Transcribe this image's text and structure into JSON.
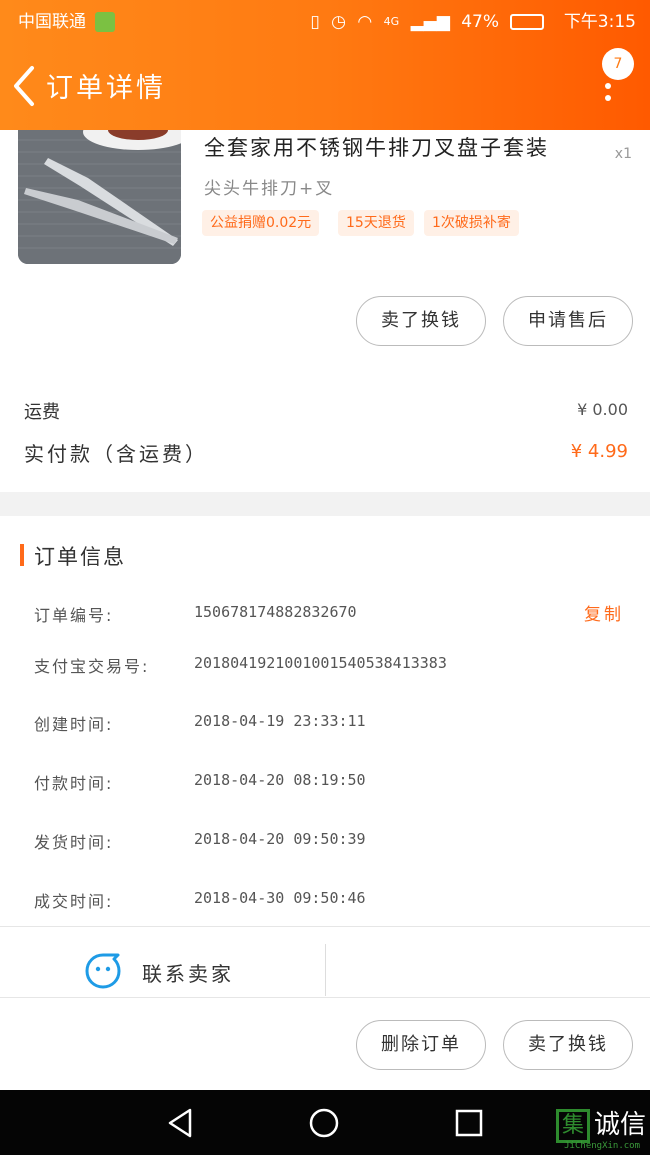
{
  "status_bar": {
    "carrier": "中国联通",
    "signal": "4G",
    "battery": "47%",
    "time": "下午3:15"
  },
  "header": {
    "title": "订单详情",
    "badge_count": "7"
  },
  "product": {
    "name": "全套家用不锈钢牛排刀叉盘子套装",
    "quantity": "x1",
    "spec": "尖头牛排刀+叉",
    "tags": [
      "公益捐赠0.02元",
      "15天退货",
      "1次破损补寄"
    ]
  },
  "product_actions": {
    "sell_label": "卖了换钱",
    "aftersale_label": "申请售后"
  },
  "pricing": {
    "shipping_label": "运费",
    "shipping_value": "¥ 0.00",
    "total_label": "实付款（含运费）",
    "total_value": "¥ 4.99"
  },
  "order_info": {
    "title": "订单信息",
    "copy_label": "复制",
    "rows": [
      {
        "label": "订单编号:",
        "value": "150678174882832670"
      },
      {
        "label": "支付宝交易号:",
        "value": "2018041921001001540538413383"
      },
      {
        "label": "创建时间:",
        "value": "2018-04-19 23:33:11"
      },
      {
        "label": "付款时间:",
        "value": "2018-04-20 08:19:50"
      },
      {
        "label": "发货时间:",
        "value": "2018-04-20 09:50:39"
      },
      {
        "label": "成交时间:",
        "value": "2018-04-30 09:50:46"
      }
    ]
  },
  "contact": {
    "label": "联系卖家"
  },
  "bottom_actions": {
    "delete_label": "删除订单",
    "sell_label": "卖了换钱"
  },
  "watermark": {
    "text": "诚信",
    "box_char": "集",
    "sub": "JiChengXin.com"
  },
  "colors": {
    "accent": "#ff6a1a",
    "header_start": "#ff8a1a",
    "header_end": "#ff5a00"
  }
}
